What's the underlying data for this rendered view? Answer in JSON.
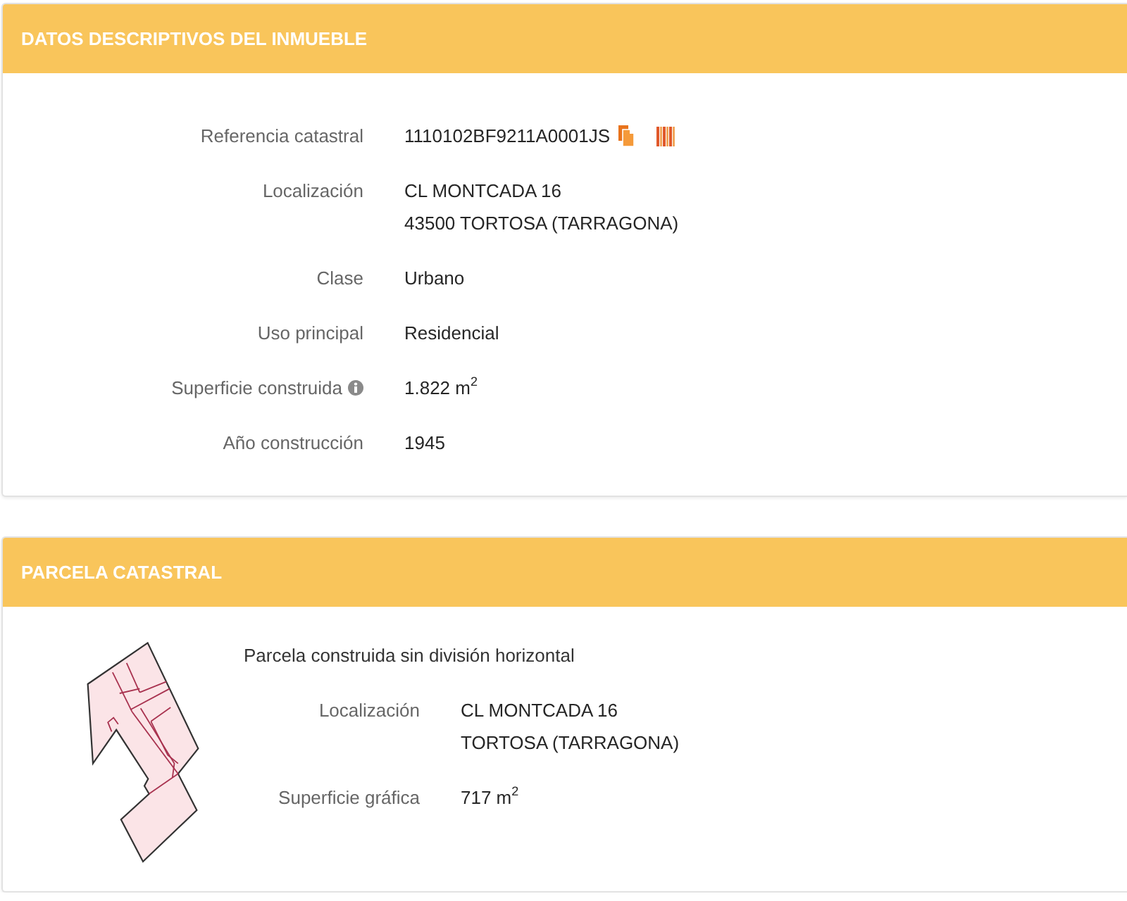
{
  "sections": [
    {
      "kind": "building",
      "title": "DATOS DESCRIPTIVOS DEL INMUEBLE",
      "rows": [
        {
          "kind": "reference",
          "label": "Referencia catastral",
          "value": "1110102BF9211A0001JS"
        },
        {
          "kind": "address",
          "label": "Localización",
          "lines": [
            "CL MONTCADA 16",
            "43500 TORTOSA (TARRAGONA)"
          ]
        },
        {
          "kind": "text",
          "label": "Clase",
          "value": "Urbano"
        },
        {
          "kind": "text",
          "label": "Uso principal",
          "value": "Residencial"
        },
        {
          "kind": "info",
          "label": "Superficie construida",
          "value": "1.822 m$^{2}$"
        },
        {
          "kind": "text",
          "label": "Año construcción",
          "value": "1945"
        }
      ]
    },
    {
      "kind": "parcel",
      "title": "PARCELA CATASTRAL",
      "description": "Parcela construida sin división horizontal",
      "rows": [
        {
          "kind": "address",
          "label": "Localización",
          "lines": [
            "CL MONTCADA 16",
            "TORTOSA (TARRAGONA)"
          ]
        },
        {
          "kind": "text",
          "label": "Superficie gráfica",
          "value": "717 m$^{2}$"
        }
      ]
    }
  ]
}
